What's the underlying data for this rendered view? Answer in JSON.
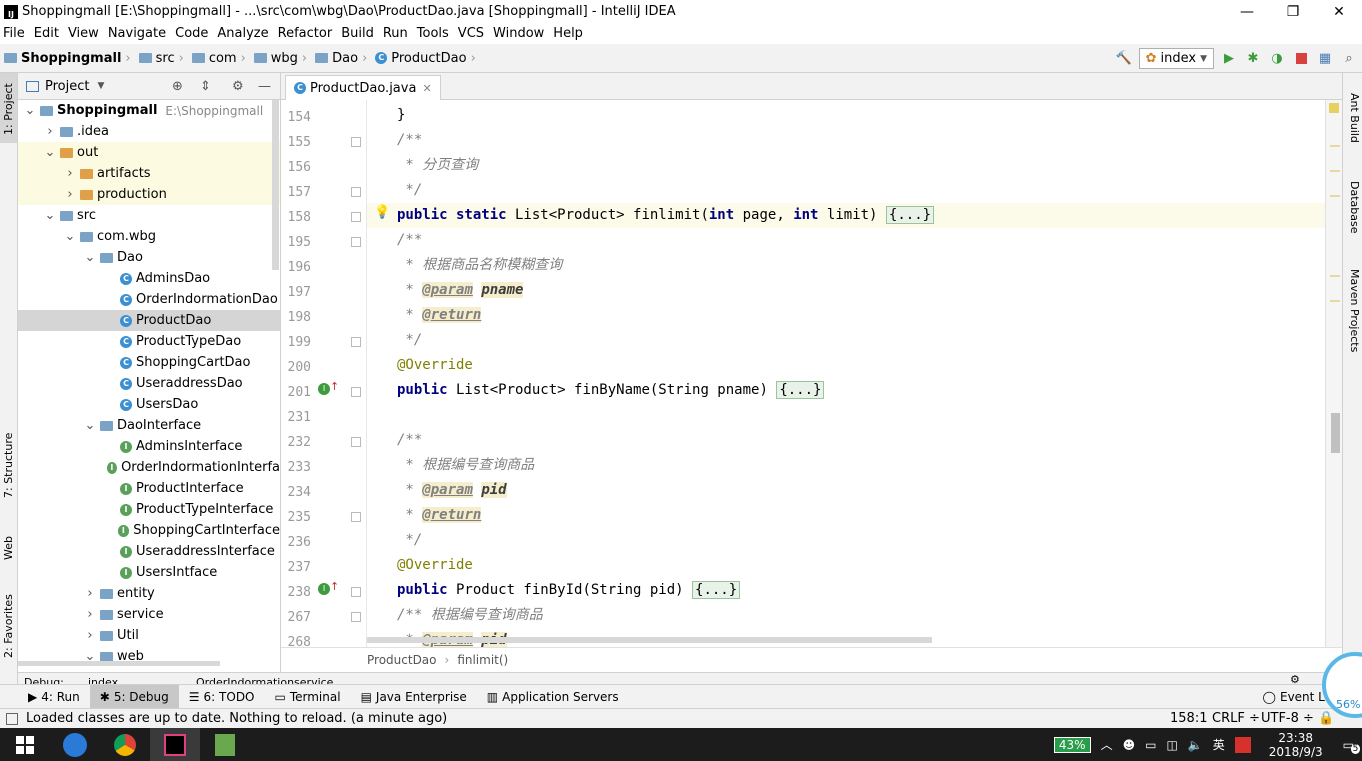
{
  "window": {
    "title": "Shoppingmall [E:\\Shoppingmall] - ...\\src\\com\\wbg\\Dao\\ProductDao.java [Shoppingmall] - IntelliJ IDEA",
    "app_icon": "IJ",
    "minimize": "—",
    "maximize": "❐",
    "close": "✕"
  },
  "menu": [
    "File",
    "Edit",
    "View",
    "Navigate",
    "Code",
    "Analyze",
    "Refactor",
    "Build",
    "Run",
    "Tools",
    "VCS",
    "Window",
    "Help"
  ],
  "nav": {
    "crumbs": [
      "Shoppingmall",
      "src",
      "com",
      "wbg",
      "Dao",
      "ProductDao"
    ],
    "run_config": "index"
  },
  "left_strip": {
    "project": "1: Project",
    "structure": "7: Structure",
    "web": "Web",
    "favorites": "2: Favorites"
  },
  "right_strip": {
    "ant": "Ant Build",
    "database": "Database",
    "maven": "Maven Projects"
  },
  "project_panel": {
    "title": "Project",
    "tree": [
      {
        "label": "Shoppingmall",
        "extra": "E:\\Shoppingmall",
        "level": 0,
        "type": "module",
        "open": true
      },
      {
        "label": ".idea",
        "level": 1,
        "type": "folder",
        "open": false
      },
      {
        "label": "out",
        "level": 1,
        "type": "ofolder",
        "open": true
      },
      {
        "label": "artifacts",
        "level": 2,
        "type": "ofolder",
        "open": false
      },
      {
        "label": "production",
        "level": 2,
        "type": "ofolder",
        "open": false
      },
      {
        "label": "src",
        "level": 1,
        "type": "folder",
        "open": true
      },
      {
        "label": "com.wbg",
        "level": 2,
        "type": "folder",
        "open": true
      },
      {
        "label": "Dao",
        "level": 3,
        "type": "folder",
        "open": true
      },
      {
        "label": "AdminsDao",
        "level": 4,
        "type": "class"
      },
      {
        "label": "OrderIndormationDao",
        "level": 4,
        "type": "class"
      },
      {
        "label": "ProductDao",
        "level": 4,
        "type": "class",
        "selected": true
      },
      {
        "label": "ProductTypeDao",
        "level": 4,
        "type": "class"
      },
      {
        "label": "ShoppingCartDao",
        "level": 4,
        "type": "class"
      },
      {
        "label": "UseraddressDao",
        "level": 4,
        "type": "class"
      },
      {
        "label": "UsersDao",
        "level": 4,
        "type": "class"
      },
      {
        "label": "DaoInterface",
        "level": 3,
        "type": "folder",
        "open": true
      },
      {
        "label": "AdminsInterface",
        "level": 4,
        "type": "interface"
      },
      {
        "label": "OrderIndormationInterfa",
        "level": 4,
        "type": "interface"
      },
      {
        "label": "ProductInterface",
        "level": 4,
        "type": "interface"
      },
      {
        "label": "ProductTypeInterface",
        "level": 4,
        "type": "interface"
      },
      {
        "label": "ShoppingCartInterface",
        "level": 4,
        "type": "interface"
      },
      {
        "label": "UseraddressInterface",
        "level": 4,
        "type": "interface"
      },
      {
        "label": "UsersIntface",
        "level": 4,
        "type": "interface"
      },
      {
        "label": "entity",
        "level": 3,
        "type": "folder",
        "open": false
      },
      {
        "label": "service",
        "level": 3,
        "type": "folder",
        "open": false
      },
      {
        "label": "Util",
        "level": 3,
        "type": "folder",
        "open": false
      },
      {
        "label": "web",
        "level": 3,
        "type": "folder",
        "open": true
      }
    ]
  },
  "editor": {
    "tab": "ProductDao.java",
    "line_numbers": [
      "154",
      "155",
      "156",
      "157",
      "158",
      "195",
      "196",
      "197",
      "198",
      "199",
      "200",
      "201",
      "231",
      "232",
      "233",
      "234",
      "235",
      "236",
      "237",
      "238",
      "267",
      "268"
    ],
    "breadcrumb": [
      "ProductDao",
      "finlimit()"
    ]
  },
  "debug_strip": [
    "Debug:",
    "index",
    "OrderIndormationservice"
  ],
  "bottom_tools": [
    {
      "label": "4: Run",
      "icon": "run-icon"
    },
    {
      "label": "5: Debug",
      "icon": "debug-icon",
      "active": true
    },
    {
      "label": "6: TODO",
      "icon": "todo-icon"
    },
    {
      "label": "Terminal",
      "icon": "terminal-icon"
    },
    {
      "label": "Java Enterprise",
      "icon": "java-ee-icon"
    },
    {
      "label": "Application Servers",
      "icon": "server-icon"
    }
  ],
  "event_log": "Event Lo",
  "status": {
    "message": "Loaded classes are up to date. Nothing to reload. (a minute ago)",
    "position": "158:1",
    "line_sep": "CRLF ÷",
    "encoding": "UTF-8 ÷",
    "overlay_percent": "56%"
  },
  "taskbar": {
    "battery": "43%",
    "ime": "英",
    "time": "23:38",
    "date": "2018/9/3",
    "notifications": "5"
  }
}
